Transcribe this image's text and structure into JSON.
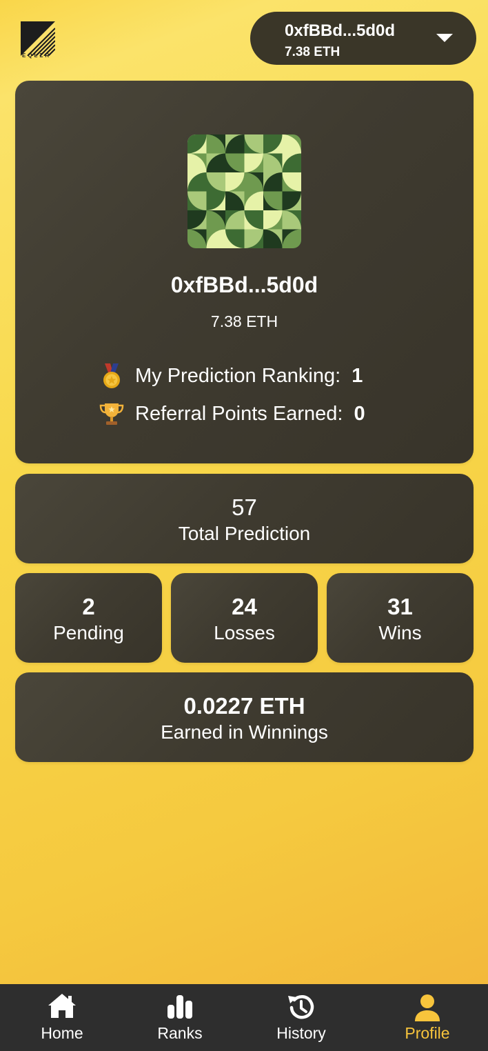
{
  "header": {
    "logo_text": "EQLZR",
    "wallet": {
      "address": "0xfBBd...5d0d",
      "balance": "7.38 ETH"
    }
  },
  "profile": {
    "address": "0xfBBd...5d0d",
    "balance": "7.38 ETH",
    "ranking_label": "My Prediction Ranking:",
    "ranking_value": "1",
    "referral_label": "Referral Points Earned:",
    "referral_value": "0"
  },
  "stats": {
    "total": {
      "value": "57",
      "label": "Total Prediction"
    },
    "pending": {
      "value": "2",
      "label": "Pending"
    },
    "losses": {
      "value": "24",
      "label": "Losses"
    },
    "wins": {
      "value": "31",
      "label": "Wins"
    },
    "earnings": {
      "value": "0.0227 ETH",
      "label": "Earned in Winnings"
    }
  },
  "tabs": [
    {
      "label": "Home",
      "icon": "home-icon",
      "active": false
    },
    {
      "label": "Ranks",
      "icon": "bar-chart-icon",
      "active": false
    },
    {
      "label": "History",
      "icon": "history-icon",
      "active": false
    },
    {
      "label": "Profile",
      "icon": "user-icon",
      "active": true
    }
  ],
  "colors": {
    "accent": "#f7c43c",
    "card": "#3f3b30",
    "tabbar": "#2e2e2e"
  }
}
